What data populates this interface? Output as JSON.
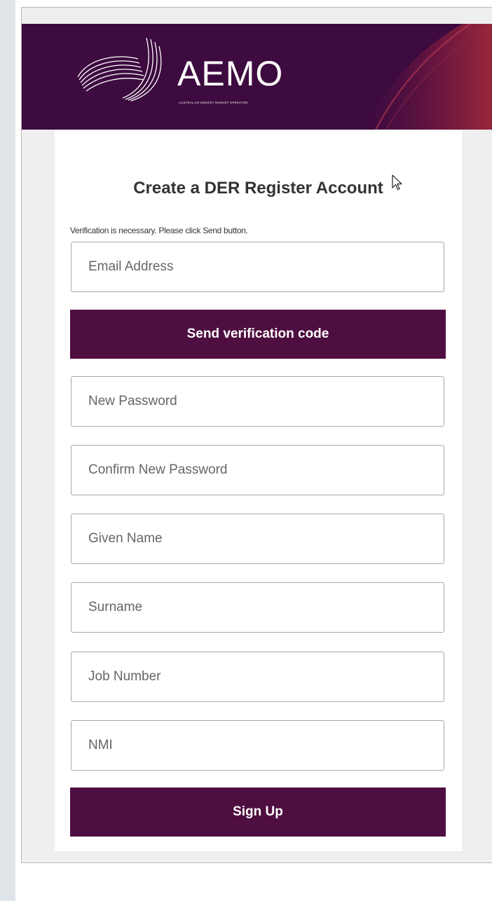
{
  "brand": {
    "name": "AEMO",
    "tagline": "AUSTRALIAN ENERGY MARKET OPERATOR",
    "header_color": "#3d0b3f",
    "button_color": "#4f0e40"
  },
  "form": {
    "title": "Create a DER Register Account",
    "verification_note": "Verification is necessary. Please click Send button.",
    "email_placeholder": "Email Address",
    "send_code_label": "Send verification code",
    "new_password_placeholder": "New Password",
    "confirm_password_placeholder": "Confirm New Password",
    "given_name_placeholder": "Given Name",
    "surname_placeholder": "Surname",
    "job_number_placeholder": "Job Number",
    "nmi_placeholder": "NMI",
    "signup_label": "Sign Up"
  }
}
